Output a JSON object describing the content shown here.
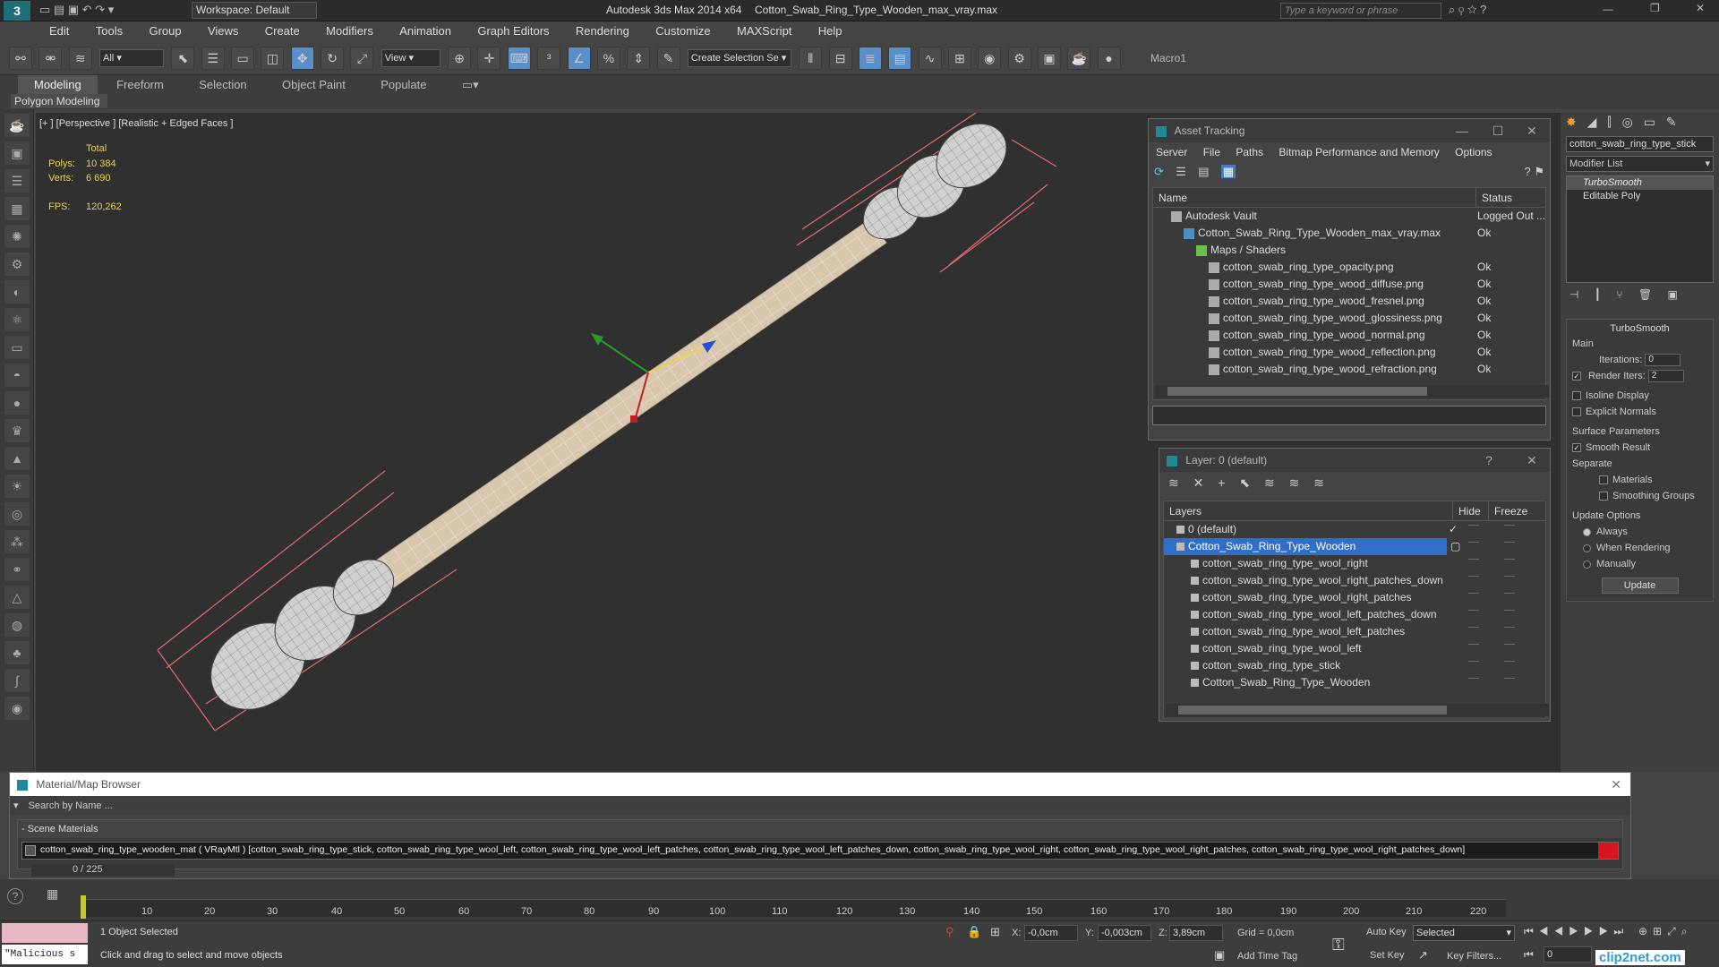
{
  "titlebar": {
    "workspace": "Workspace: Default",
    "app_title": "Autodesk 3ds Max  2014 x64",
    "file_name": "Cotton_Swab_Ring_Type_Wooden_max_vray.max",
    "search_placeholder": "Type a keyword or phrase"
  },
  "menu": [
    "Edit",
    "Tools",
    "Group",
    "Views",
    "Create",
    "Modifiers",
    "Animation",
    "Graph Editors",
    "Rendering",
    "Customize",
    "MAXScript",
    "Help"
  ],
  "toolbar": {
    "selection_filter": "All",
    "ref_coord": "View",
    "selection_set": "Create Selection Se",
    "macro": "Macro1"
  },
  "ribbon": {
    "tabs": [
      "Modeling",
      "Freeform",
      "Selection",
      "Object Paint",
      "Populate"
    ],
    "active_tab": "Modeling",
    "panel_label": "Polygon Modeling"
  },
  "viewport": {
    "label": "[+ ] [Perspective ] [Realistic + Edged Faces ]",
    "stats_total": "Total",
    "polys_label": "Polys:",
    "polys_value": "10 384",
    "verts_label": "Verts:",
    "verts_value": "6 690",
    "fps_label": "FPS:",
    "fps_value": "120,262"
  },
  "asset_tracking": {
    "title": "Asset Tracking",
    "menu": [
      "Server",
      "File",
      "Paths",
      "Bitmap Performance and Memory",
      "Options"
    ],
    "col_name": "Name",
    "col_status": "Status",
    "rows": [
      {
        "name": "Autodesk Vault",
        "status": "Logged Out ...",
        "indent": 0
      },
      {
        "name": "Cotton_Swab_Ring_Type_Wooden_max_vray.max",
        "status": "Ok",
        "indent": 1
      },
      {
        "name": "Maps / Shaders",
        "status": "",
        "indent": 2
      },
      {
        "name": "cotton_swab_ring_type_opacity.png",
        "status": "Ok",
        "indent": 3
      },
      {
        "name": "cotton_swab_ring_type_wood_diffuse.png",
        "status": "Ok",
        "indent": 3
      },
      {
        "name": "cotton_swab_ring_type_wood_fresnel.png",
        "status": "Ok",
        "indent": 3
      },
      {
        "name": "cotton_swab_ring_type_wood_glossiness.png",
        "status": "Ok",
        "indent": 3
      },
      {
        "name": "cotton_swab_ring_type_wood_normal.png",
        "status": "Ok",
        "indent": 3
      },
      {
        "name": "cotton_swab_ring_type_wood_reflection.png",
        "status": "Ok",
        "indent": 3
      },
      {
        "name": "cotton_swab_ring_type_wood_refraction.png",
        "status": "Ok",
        "indent": 3
      }
    ]
  },
  "layer_dialog": {
    "title": "Layer: 0 (default)",
    "col_layers": "Layers",
    "col_hide": "Hide",
    "col_freeze": "Freeze",
    "rows": [
      {
        "name": "0 (default)",
        "indent": 0,
        "selected": false
      },
      {
        "name": "Cotton_Swab_Ring_Type_Wooden",
        "indent": 0,
        "selected": true
      },
      {
        "name": "cotton_swab_ring_type_wool_right",
        "indent": 1,
        "selected": false
      },
      {
        "name": "cotton_swab_ring_type_wool_right_patches_down",
        "indent": 1,
        "selected": false
      },
      {
        "name": "cotton_swab_ring_type_wool_right_patches",
        "indent": 1,
        "selected": false
      },
      {
        "name": "cotton_swab_ring_type_wool_left_patches_down",
        "indent": 1,
        "selected": false
      },
      {
        "name": "cotton_swab_ring_type_wool_left_patches",
        "indent": 1,
        "selected": false
      },
      {
        "name": "cotton_swab_ring_type_wool_left",
        "indent": 1,
        "selected": false
      },
      {
        "name": "cotton_swab_ring_type_stick",
        "indent": 1,
        "selected": false
      },
      {
        "name": "Cotton_Swab_Ring_Type_Wooden",
        "indent": 1,
        "selected": false
      }
    ]
  },
  "command_panel": {
    "object_name": "cotton_swab_ring_type_stick",
    "modifier_list": "Modifier List",
    "stack": [
      "TurboSmooth",
      "Editable Poly"
    ],
    "turbosmooth_title": "TurboSmooth",
    "main_label": "Main",
    "iterations_label": "Iterations:",
    "iterations_value": "0",
    "render_iters_label": "Render Iters:",
    "render_iters_value": "2",
    "isoline": "Isoline Display",
    "explicit_normals": "Explicit Normals",
    "surface_params": "Surface Parameters",
    "smooth_result": "Smooth Result",
    "separate": "Separate",
    "materials": "Materials",
    "smoothing_groups": "Smoothing Groups",
    "update_options": "Update Options",
    "always": "Always",
    "when_rendering": "When Rendering",
    "manually": "Manually",
    "update_btn": "Update"
  },
  "material_browser": {
    "title": "Material/Map Browser",
    "search_placeholder": "Search by Name ...",
    "section": "- Scene Materials",
    "material_entry": "cotton_swab_ring_type_wooden_mat ( VRayMtl ) [cotton_swab_ring_type_stick, cotton_swab_ring_type_wool_left, cotton_swab_ring_type_wool_left_patches, cotton_swab_ring_type_wool_left_patches_down, cotton_swab_ring_type_wool_right, cotton_swab_ring_type_wool_right_patches, cotton_swab_ring_type_wool_right_patches_down]"
  },
  "timeline": {
    "frame": "0 / 225",
    "ticks": [
      "10",
      "20",
      "30",
      "40",
      "50",
      "60",
      "70",
      "80",
      "90",
      "100",
      "110",
      "120",
      "130",
      "140",
      "150",
      "160",
      "170",
      "180",
      "190",
      "200",
      "210",
      "220"
    ]
  },
  "statusbar": {
    "script_box": "\"Malicious s",
    "selected": "1 Object Selected",
    "prompt": "Click and drag to select and move objects",
    "x_label": "X:",
    "x_value": "-0,0cm",
    "y_label": "Y:",
    "y_value": "-0,003cm",
    "z_label": "Z:",
    "z_value": "3,89cm",
    "grid": "Grid = 0,0cm",
    "add_time_tag": "Add Time Tag",
    "auto_key": "Auto Key",
    "set_key": "Set Key",
    "key_mode": "Selected",
    "key_filters": "Key Filters...",
    "frame_field": "0"
  },
  "watermark": "clip2net.com"
}
